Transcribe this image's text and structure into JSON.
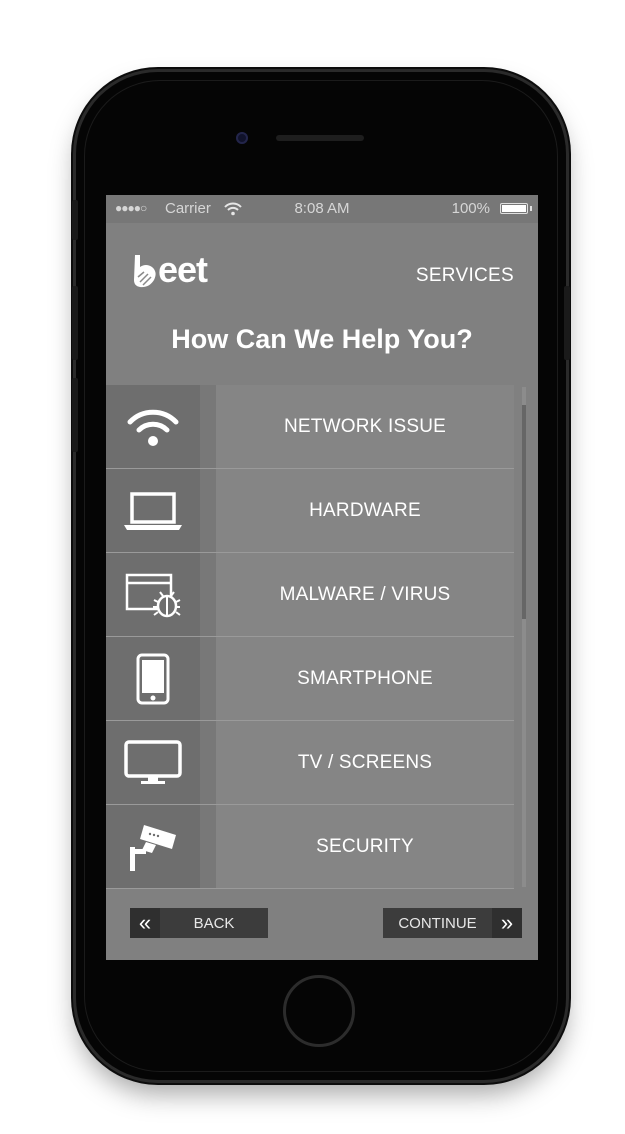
{
  "status_bar": {
    "signal": "●●●●○",
    "carrier": "Carrier",
    "time": "8:08 AM",
    "battery_percent": "100%"
  },
  "header": {
    "logo_text": "eet",
    "services_label": "SERVICES",
    "title": "How Can We Help You?"
  },
  "services": [
    {
      "label": "NETWORK ISSUE",
      "icon": "wifi-icon"
    },
    {
      "label": "HARDWARE",
      "icon": "laptop-icon"
    },
    {
      "label": "MALWARE / VIRUS",
      "icon": "malware-bug-icon"
    },
    {
      "label": "SMARTPHONE",
      "icon": "smartphone-icon"
    },
    {
      "label": "TV / SCREENS",
      "icon": "tv-monitor-icon"
    },
    {
      "label": "SECURITY",
      "icon": "security-camera-icon"
    }
  ],
  "footer": {
    "back_label": "BACK",
    "back_icon": "«",
    "continue_label": "CONTINUE",
    "continue_icon": "»"
  },
  "colors": {
    "screen_bg": "#808080",
    "icon_cell_bg": "#6e6e6e",
    "button_bg": "#3c3c3c",
    "text": "#ffffff"
  }
}
